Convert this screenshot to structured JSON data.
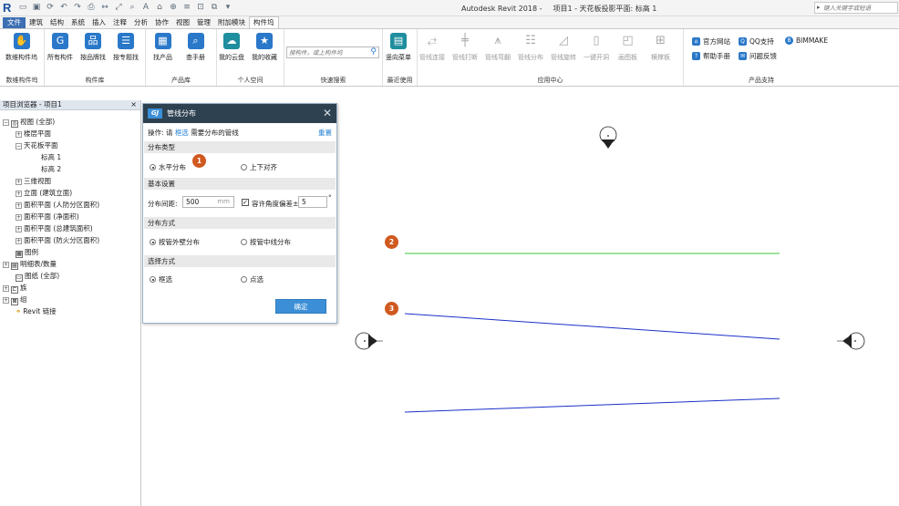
{
  "window": {
    "app_title": "Autodesk Revit 2018 -",
    "doc_title": "项目1 - 天花板投影平面: 标高 1",
    "search_placeholder": "键入关键字或短语"
  },
  "tabs": [
    "文件",
    "建筑",
    "结构",
    "系统",
    "插入",
    "注释",
    "分析",
    "协作",
    "视图",
    "管理",
    "附加模块",
    "构件坞"
  ],
  "active_tab": "构件坞",
  "ribbon": {
    "groups": {
      "g1": "数维构件坞",
      "g2": "构件库",
      "g3": "产品库",
      "g4": "个人空间",
      "g5": "快速搜索",
      "g6": "最近使用",
      "g7": "应用中心",
      "g8": "产品支持"
    },
    "buttons": {
      "shuwei": "数维构件坞",
      "all": "所有构件",
      "by_product": "按品牌找",
      "by_special": "按专题找",
      "find_product": "找产品",
      "manual": "查手册",
      "my_cloud": "我的云盘",
      "my_fav": "我的收藏",
      "search_placeholder": "搜构件，或上构件坞",
      "recent": "竖向菜单",
      "pipe_connect": "管线连接",
      "pipe_break": "管线打断",
      "pipe_avoid": "管线弯翻",
      "pipe_dist": "管线分布",
      "pipe_rotate": "管线旋转",
      "one_click": "一键开洞",
      "hanger": "画图板",
      "support": "横撑板"
    },
    "support": {
      "website": "官方网站",
      "qq": "QQ支持",
      "bimmake": "BIMMAKE",
      "help": "帮助手册",
      "feedback": "问题反馈"
    }
  },
  "browser": {
    "title": "项目浏览器 - 项目1",
    "nodes": {
      "views": "视图 (全部)",
      "floor_plan": "楼层平面",
      "ceiling_plan": "天花板平面",
      "level1": "标高 1",
      "level2": "标高 2",
      "view3d": "三维视图",
      "elevation": "立面 (建筑立面)",
      "area1": "面积平面 (人防分区面积)",
      "area2": "面积平面 (净面积)",
      "area3": "面积平面 (总建筑面积)",
      "area4": "面积平面 (防火分区面积)",
      "legend": "图例",
      "schedules": "明细表/数量",
      "sheets": "图纸 (全部)",
      "families": "族",
      "groups": "组",
      "links": "Revit 链接"
    }
  },
  "dialog": {
    "title": "管线分布",
    "op_prefix": "操作: 请",
    "op_highlight": "框选",
    "op_suffix": "需要分布的管线",
    "reset": "重置",
    "sec_type": "分布类型",
    "opt_horizontal": "水平分布",
    "opt_vertical": "上下对齐",
    "sec_basic": "基本设置",
    "spacing_label": "分布间距:",
    "spacing_value": "500",
    "spacing_unit": "mm",
    "angle_label": "容许角度偏差±",
    "angle_value": "5",
    "angle_unit": "°",
    "sec_mode": "分布方式",
    "opt_outer": "按管外壁分布",
    "opt_center": "按管中线分布",
    "sec_select": "选择方式",
    "opt_box": "框选",
    "opt_click": "点选",
    "ok": "确定"
  },
  "badges": [
    "1",
    "2",
    "3"
  ],
  "colors": {
    "accent": "#2a78c9",
    "badge": "#d0591f",
    "dialog_header": "#2d4151",
    "pipe_green": "#3cc43c",
    "pipe_blue": "#1c2fc8"
  }
}
